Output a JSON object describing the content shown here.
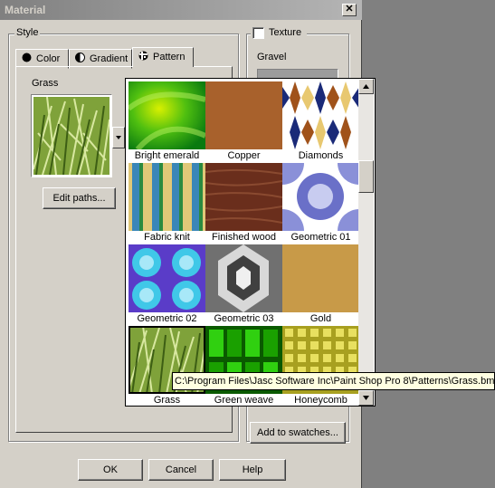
{
  "window": {
    "title": "Material",
    "close_glyph": "✕"
  },
  "style_group": {
    "label": "Style"
  },
  "tabs": [
    {
      "label": "Color",
      "icon": "circle-icon"
    },
    {
      "label": "Gradient",
      "icon": "half-circle-icon"
    },
    {
      "label": "Pattern",
      "icon": "pattern-icon"
    }
  ],
  "pattern_panel": {
    "current_label": "Grass",
    "edit_paths_label": "Edit paths..."
  },
  "texture": {
    "checkbox_label": "Texture",
    "checked": false,
    "current_label": "Gravel"
  },
  "pattern_grid": {
    "items": [
      {
        "label": "Bright emerald"
      },
      {
        "label": "Copper"
      },
      {
        "label": "Diamonds"
      },
      {
        "label": "Fabric knit"
      },
      {
        "label": "Finished wood"
      },
      {
        "label": "Geometric 01"
      },
      {
        "label": "Geometric 02"
      },
      {
        "label": "Geometric 03"
      },
      {
        "label": "Gold"
      },
      {
        "label": "Grass",
        "selected": true
      },
      {
        "label": "Green weave"
      },
      {
        "label": "Honeycomb"
      }
    ]
  },
  "tooltip": {
    "text": "C:\\Program Files\\Jasc Software Inc\\Paint Shop Pro 8\\Patterns\\Grass.bmp"
  },
  "buttons": {
    "add_to_swatches": "Add to swatches...",
    "ok": "OK",
    "cancel": "Cancel",
    "help": "Help"
  },
  "colors": {
    "dialog_bg": "#d4d0c8",
    "desktop_bg": "#808080",
    "tooltip_bg": "#ffffe1"
  }
}
